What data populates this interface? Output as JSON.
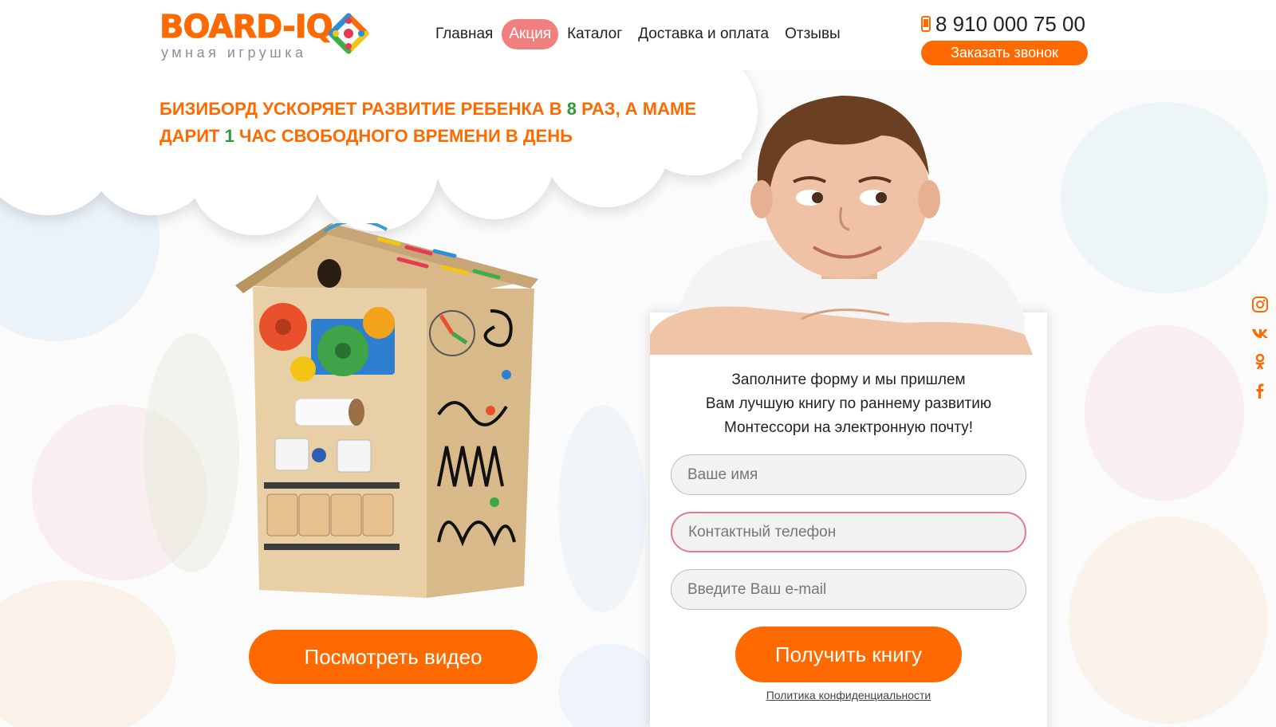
{
  "brand": {
    "name": "BOARD-IQ",
    "tagline": "умная игрушка",
    "colors": {
      "accent": "#ff6a00",
      "active_nav": "#f08080",
      "green": "#2e9b3a"
    }
  },
  "nav": {
    "items": [
      {
        "label": "Главная",
        "active": false
      },
      {
        "label": "Акция",
        "active": true
      },
      {
        "label": "Каталог",
        "active": false
      },
      {
        "label": "Доставка и оплата",
        "active": false
      },
      {
        "label": "Отзывы",
        "active": false
      }
    ]
  },
  "contact": {
    "phone": "8 910 000 75 00",
    "call_button": "Заказать звонок",
    "phone_icon": "mobile-phone-icon"
  },
  "hero": {
    "headline_part1": "БИЗИБОРД УСКОРЯЕТ РАЗВИТИЕ РЕБЕНКА В ",
    "headline_num1": "8",
    "headline_part2": " РАЗ, А МАМЕ ДАРИТ ",
    "headline_num2": "1",
    "headline_part3": " ЧАС СВОБОДНОГО ВРЕМЕНИ В ДЕНЬ",
    "video_button": "Посмотреть видео"
  },
  "form": {
    "intro_line1": "Заполните форму и мы пришлем",
    "intro_line2": "Вам лучшую книгу по раннему развитию",
    "intro_line3": "Монтессори на электронную почту!",
    "name_placeholder": "Ваше имя",
    "phone_placeholder": "Контактный телефон",
    "email_placeholder": "Введите Ваш e-mail",
    "submit": "Получить книгу",
    "policy": "Политика конфиденциальности"
  },
  "social": [
    "instagram-icon",
    "vk-icon",
    "odnoklassniki-icon",
    "facebook-icon"
  ]
}
